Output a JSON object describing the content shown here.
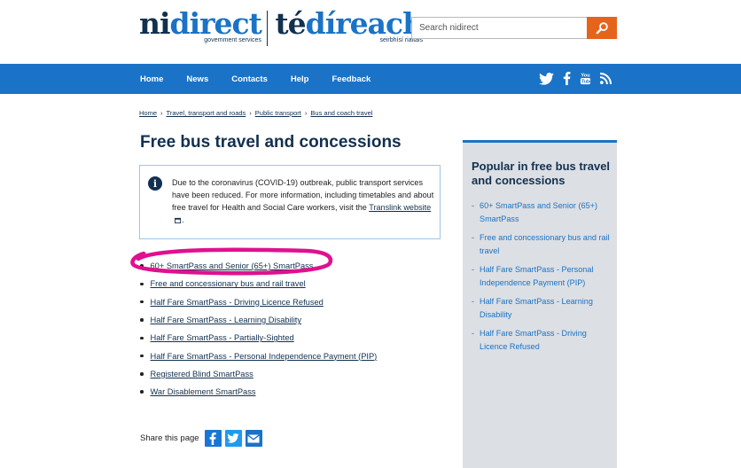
{
  "header": {
    "logo_left": {
      "part1": "ni",
      "part2": "direct",
      "sub": "government services"
    },
    "logo_right": {
      "part1": "té",
      "part2": "díreach",
      "sub": "seirbhísí rialtais"
    },
    "search": {
      "placeholder": "Search nidirect",
      "value": ""
    },
    "search_icon": "search-icon"
  },
  "nav": {
    "items": [
      "Home",
      "News",
      "Contacts",
      "Help",
      "Feedback"
    ],
    "social_icons": [
      "twitter-icon",
      "facebook-icon",
      "youtube-icon",
      "rss-icon"
    ]
  },
  "breadcrumb": {
    "items": [
      "Home",
      "Travel, transport and roads",
      "Public transport",
      "Bus and coach travel"
    ],
    "separator": "›"
  },
  "page_title": "Free bus travel and concessions",
  "alert": {
    "icon": "info-icon",
    "text_before": "Due to the coronavirus (COVID-19) outbreak, public transport services have been reduced. For more information, including timetables and about free travel for Health and Social Care workers, visit the ",
    "link_text": "Translink website",
    "text_after": "."
  },
  "links": [
    "60+ SmartPass and Senior (65+) SmartPass",
    "Free and concessionary bus and rail travel",
    "Half Fare SmartPass - Driving Licence Refused",
    "Half Fare SmartPass - Learning Disability",
    "Half Fare SmartPass - Partially-Sighted",
    "Half Fare SmartPass - Personal Independence Payment (PIP)",
    "Registered Blind SmartPass",
    "War Disablement SmartPass"
  ],
  "share": {
    "label": "Share this page",
    "icons": [
      "facebook-icon",
      "twitter-icon",
      "email-icon"
    ]
  },
  "sidebar": {
    "title": "Popular in free bus travel and concessions",
    "items": [
      "60+ SmartPass and Senior (65+) SmartPass",
      "Free and concessionary bus and rail travel",
      "Half Fare SmartPass - Personal Independence Payment (PIP)",
      "Half Fare SmartPass - Learning Disability",
      "Half Fare SmartPass - Driving Licence Refused"
    ],
    "bullet": "-"
  },
  "colors": {
    "brand_blue": "#1a73c7",
    "navy": "#12304f",
    "search_orange": "#e5641c",
    "sidebar_bg": "#dcdfe4",
    "annotation_magenta": "#e0108f",
    "facebook": "#1877d6",
    "twitter": "#1d9bf0",
    "email": "#1a73c7"
  }
}
